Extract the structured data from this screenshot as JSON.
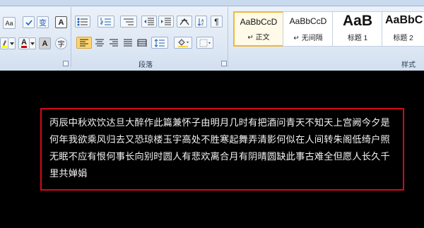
{
  "ribbon": {
    "groups": {
      "paragraph": "段落",
      "styles": "样式"
    },
    "font": {
      "aa_glyph": "A",
      "change_case_glyph": "Aa",
      "wen_glyph": "变",
      "border_glyph": "A",
      "char_shading_glyph": "A",
      "enclose_glyph": "字",
      "font_color_glyph": "A"
    },
    "styles": [
      {
        "sample": "AaBbCcD",
        "name": "↵ 正文",
        "active": true
      },
      {
        "sample": "AaBbCcD",
        "name": "↵ 无间隔",
        "active": false
      },
      {
        "sample": "AaB",
        "name": "标题 1",
        "active": false
      },
      {
        "sample": "AaBbC",
        "name": "标题 2",
        "active": false
      }
    ],
    "colors": {
      "ribbon_bg": "#dde7f4",
      "selected": "#ffd56e",
      "highlight": "#ffff00",
      "font_color": "#d00000"
    }
  },
  "document": {
    "text": "丙辰中秋欢饮达旦大醉作此篇兼怀子由明月几时有把酒问青天不知天上宫阙今夕是何年我欲乘风归去又恐琼楼玉宇高处不胜寒起舞弄清影何似在人间转朱阁低绮户照无眠不应有恨何事长向别时圆人有悲欢离合月有阴晴圆缺此事古难全但愿人长久千里共婵娟",
    "box_color": "#d10a1e",
    "bg": "#000000"
  }
}
